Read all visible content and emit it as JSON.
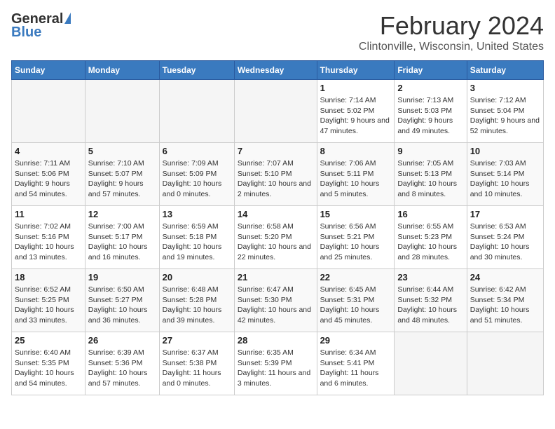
{
  "app": {
    "logo_general": "General",
    "logo_blue": "Blue",
    "title": "February 2024",
    "subtitle": "Clintonville, Wisconsin, United States"
  },
  "calendar": {
    "headers": [
      "Sunday",
      "Monday",
      "Tuesday",
      "Wednesday",
      "Thursday",
      "Friday",
      "Saturday"
    ],
    "weeks": [
      [
        {
          "day": "",
          "info": ""
        },
        {
          "day": "",
          "info": ""
        },
        {
          "day": "",
          "info": ""
        },
        {
          "day": "",
          "info": ""
        },
        {
          "day": "1",
          "info": "Sunrise: 7:14 AM\nSunset: 5:02 PM\nDaylight: 9 hours and 47 minutes."
        },
        {
          "day": "2",
          "info": "Sunrise: 7:13 AM\nSunset: 5:03 PM\nDaylight: 9 hours and 49 minutes."
        },
        {
          "day": "3",
          "info": "Sunrise: 7:12 AM\nSunset: 5:04 PM\nDaylight: 9 hours and 52 minutes."
        }
      ],
      [
        {
          "day": "4",
          "info": "Sunrise: 7:11 AM\nSunset: 5:06 PM\nDaylight: 9 hours and 54 minutes."
        },
        {
          "day": "5",
          "info": "Sunrise: 7:10 AM\nSunset: 5:07 PM\nDaylight: 9 hours and 57 minutes."
        },
        {
          "day": "6",
          "info": "Sunrise: 7:09 AM\nSunset: 5:09 PM\nDaylight: 10 hours and 0 minutes."
        },
        {
          "day": "7",
          "info": "Sunrise: 7:07 AM\nSunset: 5:10 PM\nDaylight: 10 hours and 2 minutes."
        },
        {
          "day": "8",
          "info": "Sunrise: 7:06 AM\nSunset: 5:11 PM\nDaylight: 10 hours and 5 minutes."
        },
        {
          "day": "9",
          "info": "Sunrise: 7:05 AM\nSunset: 5:13 PM\nDaylight: 10 hours and 8 minutes."
        },
        {
          "day": "10",
          "info": "Sunrise: 7:03 AM\nSunset: 5:14 PM\nDaylight: 10 hours and 10 minutes."
        }
      ],
      [
        {
          "day": "11",
          "info": "Sunrise: 7:02 AM\nSunset: 5:16 PM\nDaylight: 10 hours and 13 minutes."
        },
        {
          "day": "12",
          "info": "Sunrise: 7:00 AM\nSunset: 5:17 PM\nDaylight: 10 hours and 16 minutes."
        },
        {
          "day": "13",
          "info": "Sunrise: 6:59 AM\nSunset: 5:18 PM\nDaylight: 10 hours and 19 minutes."
        },
        {
          "day": "14",
          "info": "Sunrise: 6:58 AM\nSunset: 5:20 PM\nDaylight: 10 hours and 22 minutes."
        },
        {
          "day": "15",
          "info": "Sunrise: 6:56 AM\nSunset: 5:21 PM\nDaylight: 10 hours and 25 minutes."
        },
        {
          "day": "16",
          "info": "Sunrise: 6:55 AM\nSunset: 5:23 PM\nDaylight: 10 hours and 28 minutes."
        },
        {
          "day": "17",
          "info": "Sunrise: 6:53 AM\nSunset: 5:24 PM\nDaylight: 10 hours and 30 minutes."
        }
      ],
      [
        {
          "day": "18",
          "info": "Sunrise: 6:52 AM\nSunset: 5:25 PM\nDaylight: 10 hours and 33 minutes."
        },
        {
          "day": "19",
          "info": "Sunrise: 6:50 AM\nSunset: 5:27 PM\nDaylight: 10 hours and 36 minutes."
        },
        {
          "day": "20",
          "info": "Sunrise: 6:48 AM\nSunset: 5:28 PM\nDaylight: 10 hours and 39 minutes."
        },
        {
          "day": "21",
          "info": "Sunrise: 6:47 AM\nSunset: 5:30 PM\nDaylight: 10 hours and 42 minutes."
        },
        {
          "day": "22",
          "info": "Sunrise: 6:45 AM\nSunset: 5:31 PM\nDaylight: 10 hours and 45 minutes."
        },
        {
          "day": "23",
          "info": "Sunrise: 6:44 AM\nSunset: 5:32 PM\nDaylight: 10 hours and 48 minutes."
        },
        {
          "day": "24",
          "info": "Sunrise: 6:42 AM\nSunset: 5:34 PM\nDaylight: 10 hours and 51 minutes."
        }
      ],
      [
        {
          "day": "25",
          "info": "Sunrise: 6:40 AM\nSunset: 5:35 PM\nDaylight: 10 hours and 54 minutes."
        },
        {
          "day": "26",
          "info": "Sunrise: 6:39 AM\nSunset: 5:36 PM\nDaylight: 10 hours and 57 minutes."
        },
        {
          "day": "27",
          "info": "Sunrise: 6:37 AM\nSunset: 5:38 PM\nDaylight: 11 hours and 0 minutes."
        },
        {
          "day": "28",
          "info": "Sunrise: 6:35 AM\nSunset: 5:39 PM\nDaylight: 11 hours and 3 minutes."
        },
        {
          "day": "29",
          "info": "Sunrise: 6:34 AM\nSunset: 5:41 PM\nDaylight: 11 hours and 6 minutes."
        },
        {
          "day": "",
          "info": ""
        },
        {
          "day": "",
          "info": ""
        }
      ]
    ]
  }
}
